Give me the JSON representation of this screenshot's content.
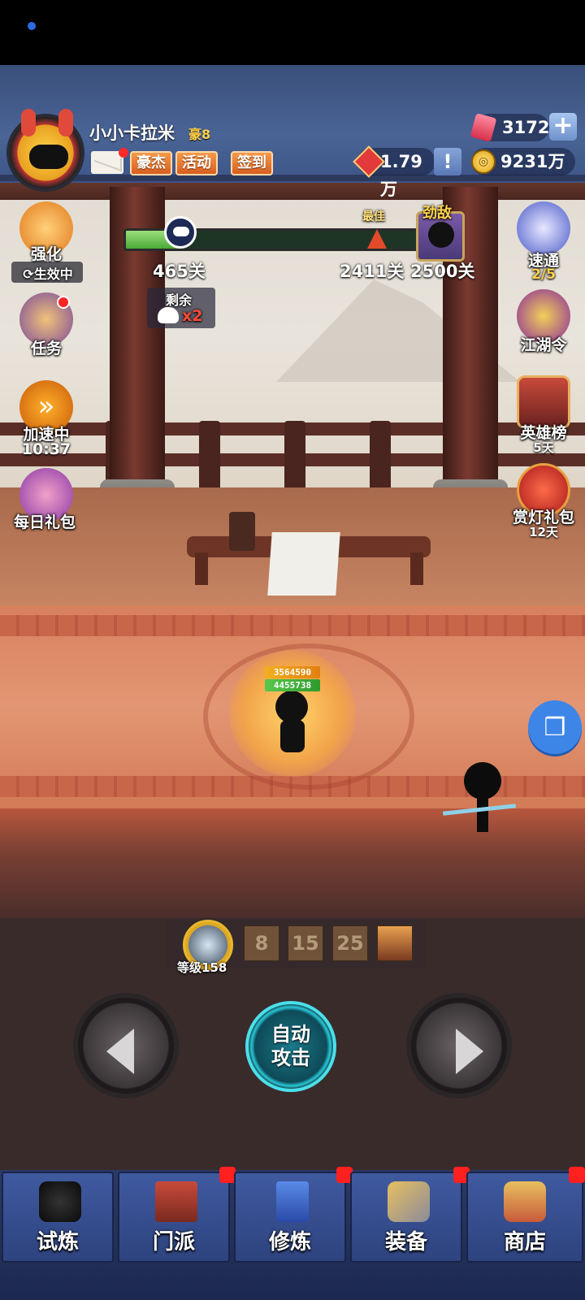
{
  "header": {
    "username": "小小卡拉米",
    "vip_level": "豪8",
    "buttons": {
      "heroes": "豪杰",
      "events": "活动",
      "checkin": "签到"
    },
    "gems": "3172",
    "honor": "1.79万",
    "coins": "9231万",
    "honor_badge": "誉"
  },
  "progress": {
    "current_stage": "465关",
    "best_label": "最佳",
    "best_stage": "2411关",
    "boss_label": "劲敌",
    "boss_stage": "2500关",
    "remaining_label": "剩余",
    "remaining_count": "x2",
    "fill_fraction": 0.186
  },
  "left_buttons": [
    {
      "label": "强化",
      "sub": "生效中"
    },
    {
      "label": "任务"
    },
    {
      "label": "加速中",
      "sub": "10:37"
    },
    {
      "label": "每日礼包"
    }
  ],
  "right_buttons": [
    {
      "label": "速通",
      "sub": "2/5"
    },
    {
      "label": "江湖令"
    },
    {
      "label": "英雄榜",
      "sub": "5天"
    },
    {
      "label": "赏灯礼包",
      "sub": "12天"
    }
  ],
  "battle": {
    "hp_top": "3564590",
    "hp_bottom": "4455738"
  },
  "skills": {
    "level_label": "等级158",
    "slots": [
      "8",
      "15",
      "25"
    ]
  },
  "controls": {
    "auto_line1": "自动",
    "auto_line2": "攻击"
  },
  "nav": [
    {
      "label": "试炼"
    },
    {
      "label": "门派"
    },
    {
      "label": "修炼"
    },
    {
      "label": "装备"
    },
    {
      "label": "商店"
    }
  ],
  "colors": {
    "accent": "#3d86e8",
    "danger": "#ff2424",
    "header": "#4a6496"
  }
}
